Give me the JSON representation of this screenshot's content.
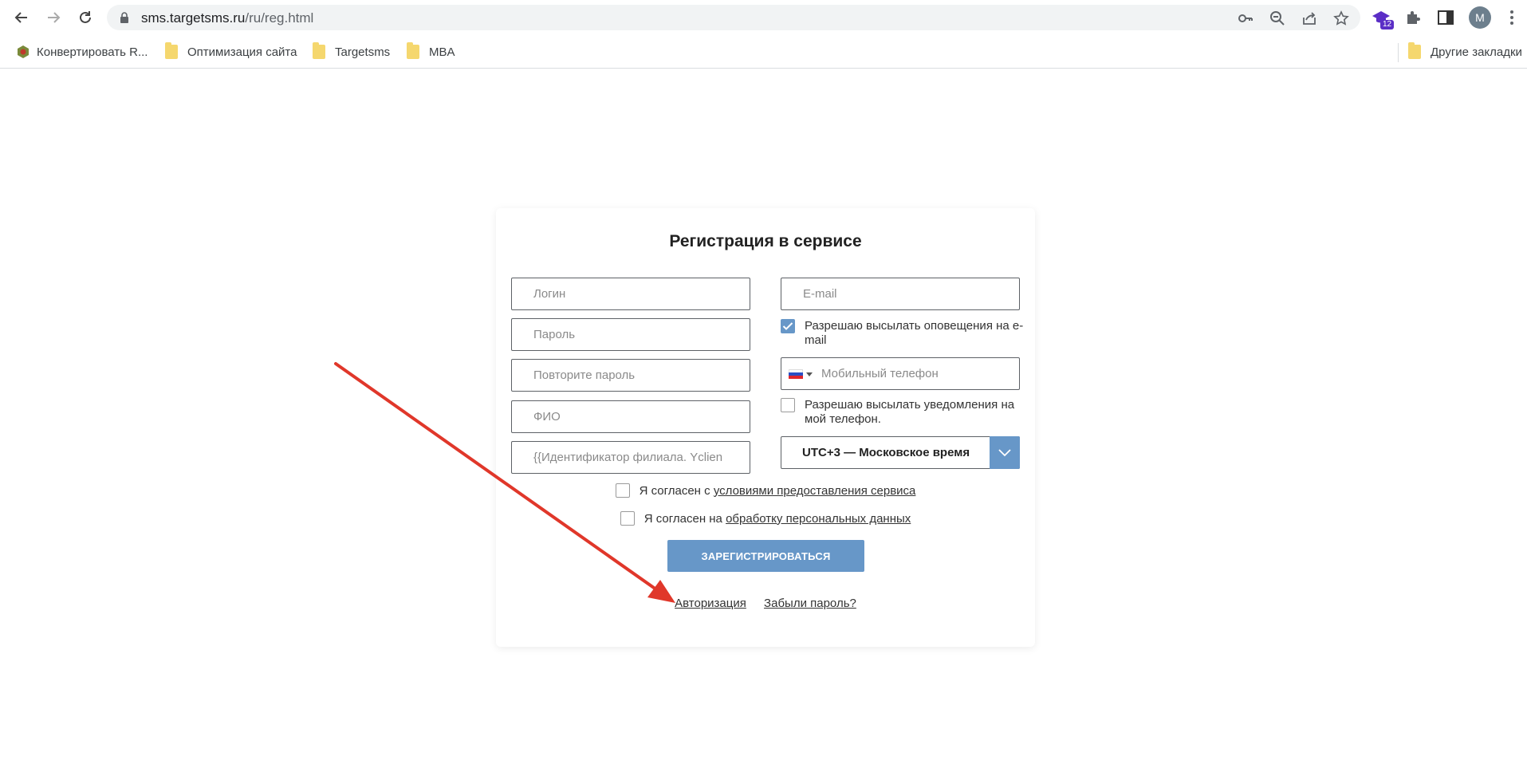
{
  "browser": {
    "url_host": "sms.targetsms.ru",
    "url_path": "/ru/reg.html",
    "profile_initial": "M",
    "extension_badge": "12"
  },
  "bookmarks": {
    "items": [
      {
        "label": "Конвертировать R...",
        "icon": "site-favicon-icon"
      },
      {
        "label": "Оптимизация сайта",
        "icon": "folder-icon"
      },
      {
        "label": "Targetsms",
        "icon": "folder-icon"
      },
      {
        "label": "MBA",
        "icon": "folder-icon"
      }
    ],
    "other": "Другие закладки"
  },
  "form": {
    "title": "Регистрация в сервисе",
    "login_placeholder": "Логин",
    "password_placeholder": "Пароль",
    "repeat_password_placeholder": "Повторите пароль",
    "fullname_placeholder": "ФИО",
    "branch_placeholder": "{{Идентификатор филиала. Yclien",
    "email_placeholder": "E-mail",
    "email_notify_label": "Разрешаю высылать оповещения на e-mail",
    "email_notify_checked": true,
    "phone_placeholder": "Мобильный телефон",
    "phone_notify_label": "Разрешаю высылать уведомления на мой телефон.",
    "phone_notify_checked": false,
    "timezone_value": "UTC+3 — Московское время,",
    "terms_prefix": "Я согласен с",
    "terms_link": "условиями предоставления сервиса",
    "personal_prefix": "Я согласен на",
    "personal_link": "обработку персональных данных",
    "register_button": "ЗАРЕГИСТРИРОВАТЬСЯ",
    "auth_link": "Авторизация",
    "forgot_link": "Забыли пароль?"
  },
  "colors": {
    "accent": "#6797c8",
    "annotation_arrow": "#e0372a"
  }
}
